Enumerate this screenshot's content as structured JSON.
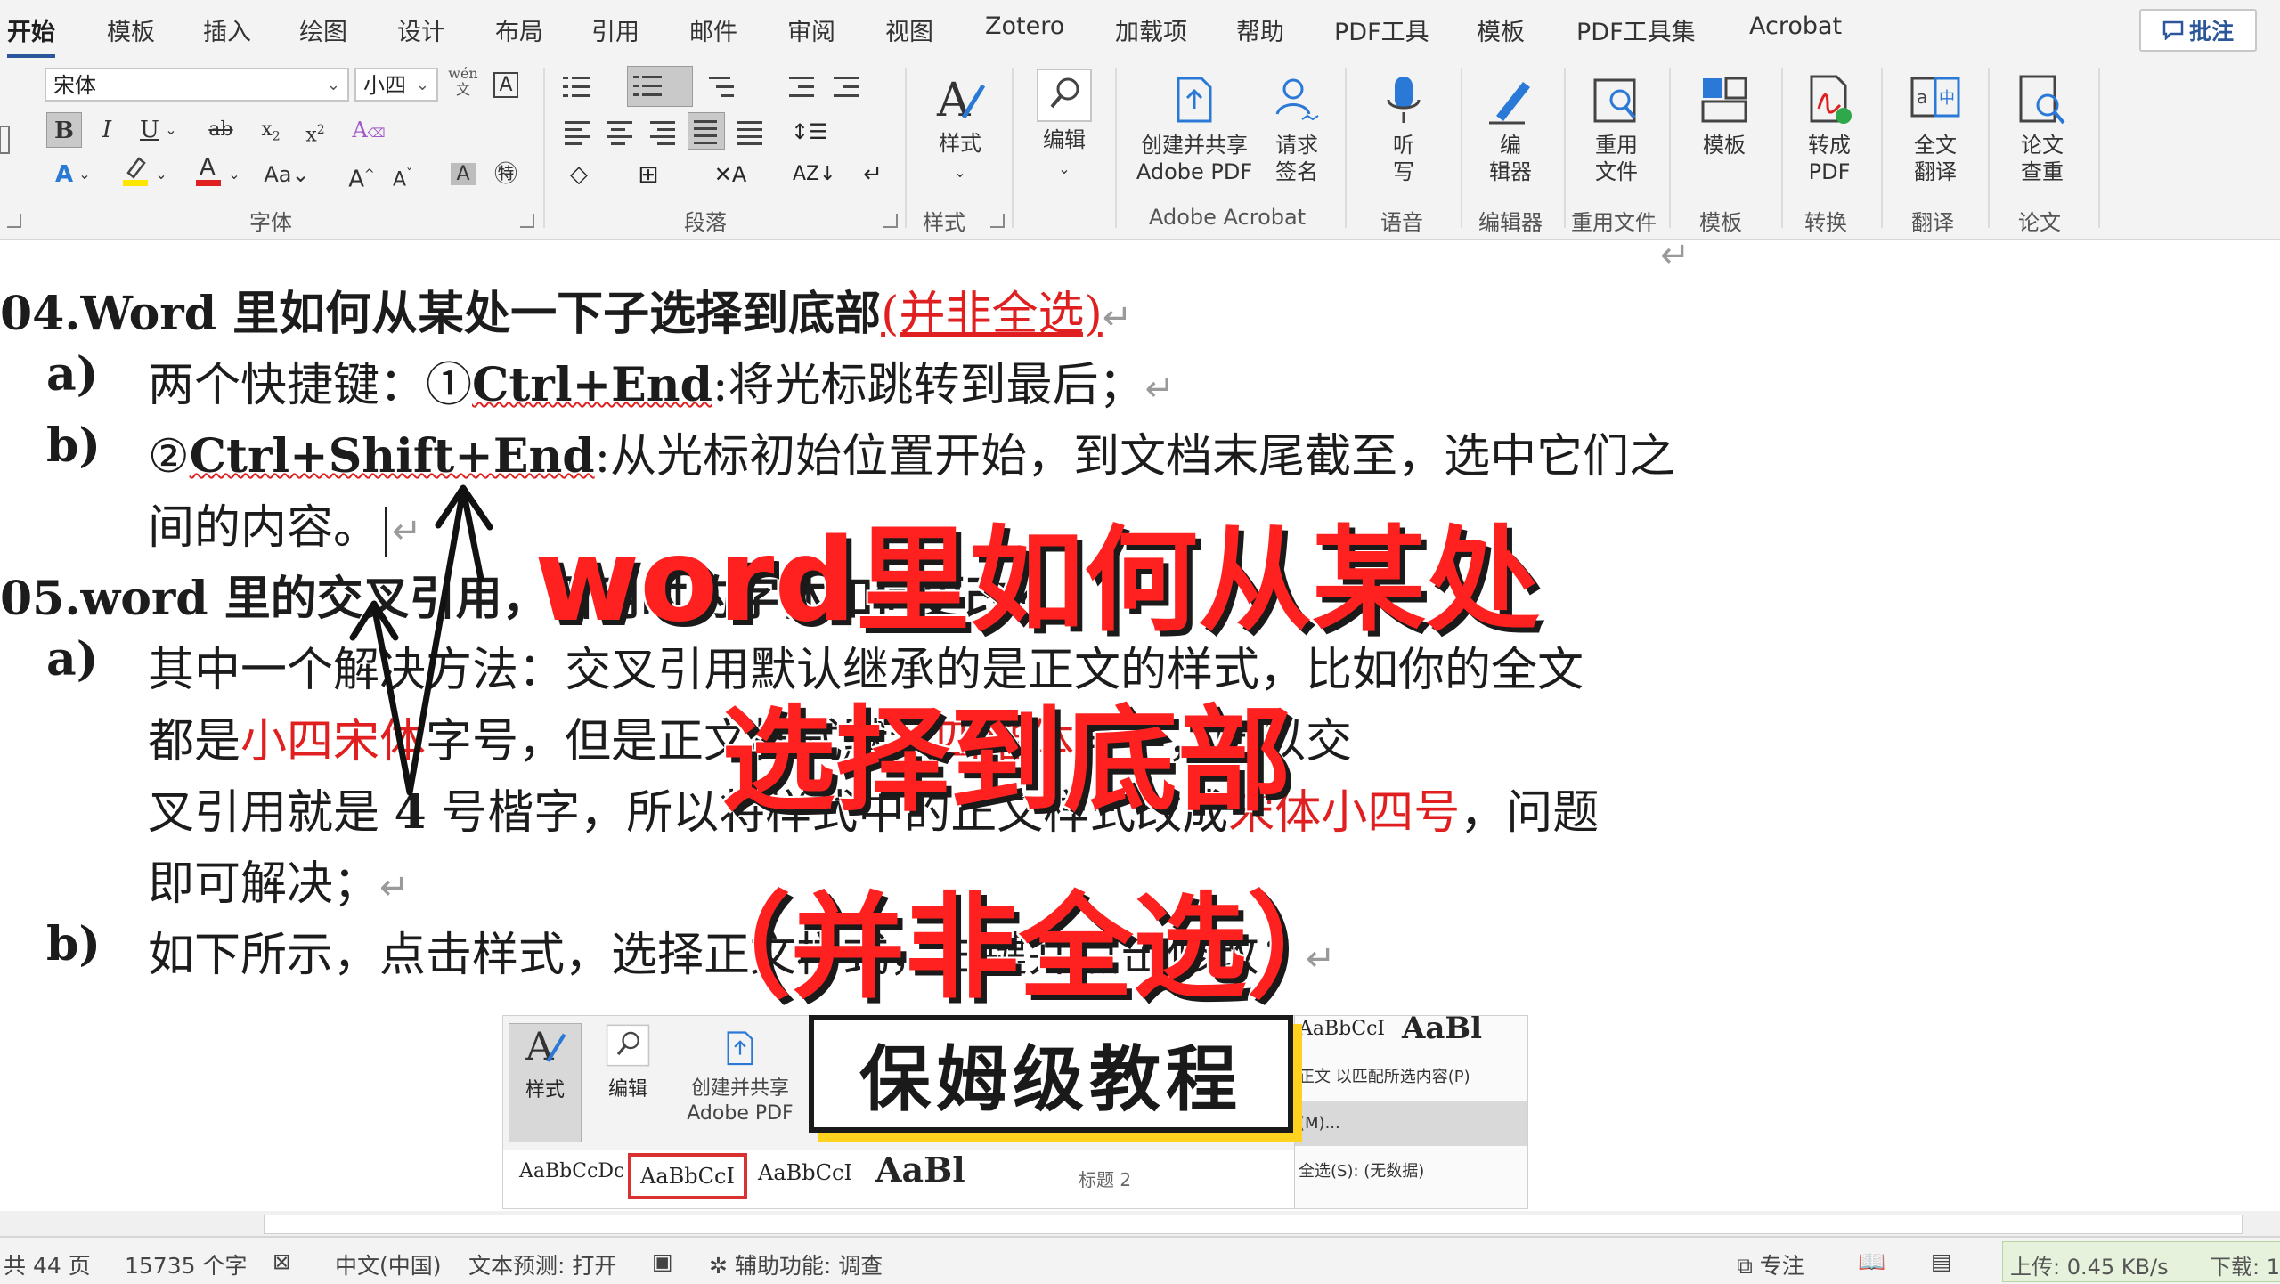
{
  "menu": {
    "tabs": [
      "开始",
      "模板",
      "插入",
      "绘图",
      "设计",
      "布局",
      "引用",
      "邮件",
      "审阅",
      "视图",
      "Zotero",
      "加载项",
      "帮助",
      "PDF工具",
      "模板",
      "PDF工具集",
      "Acrobat"
    ],
    "active_tab": "开始",
    "comment_label": "批注"
  },
  "ribbon": {
    "font": {
      "family": "宋体",
      "size": "小四",
      "group_label": "字体"
    },
    "paragraph": {
      "group_label": "段落"
    },
    "styles": {
      "button_label": "样式",
      "group_label": "样式"
    },
    "editing": {
      "button_label": "编辑"
    },
    "adobe": {
      "create_share_1": "创建并共享",
      "create_share_2": "Adobe PDF",
      "request_sign_1": "请求",
      "request_sign_2": "签名",
      "group_label": "Adobe Acrobat"
    },
    "voice": {
      "dictate_1": "听",
      "dictate_2": "写",
      "group_label": "语音"
    },
    "editor": {
      "button_1": "编",
      "button_2": "辑器",
      "group_label": "编辑器"
    },
    "reuse": {
      "button_1": "重用",
      "button_2": "文件",
      "group_label": "重用文件"
    },
    "template": {
      "button_label": "模板",
      "group_label": "模板"
    },
    "convert": {
      "button_1": "转成",
      "button_2": "PDF",
      "group_label": "转换"
    },
    "translate": {
      "button_1": "全文",
      "button_2": "翻译",
      "group_label": "翻译"
    },
    "thesis": {
      "button_1": "论文",
      "button_2": "查重",
      "group_label": "论文"
    },
    "colors": {
      "accent": "#2b579a",
      "highlight": "#ffe600",
      "font_color": "#e02020"
    }
  },
  "document": {
    "q4_title_prefix": "04.Word 里如何从某处一下子选择到底部",
    "q4_title_red": "(并非全选)",
    "q4_a_label": "a)",
    "q4_a_text1": "两个快捷键：①",
    "q4_a_bold": "Ctrl+End",
    "q4_a_text2": ":将光标跳转到最后；",
    "q4_b_label": "b)",
    "q4_b_text1": "②",
    "q4_b_bold": "Ctrl+Shift+End",
    "q4_b_text2": ":从光标初始位置开始，到文档末尾截至，选中它们之",
    "q4_b_text3": "间的内容。",
    "q5_title": "05.word 里的交叉引用，引用时的字体如何更改？",
    "q5_a_label": "a)",
    "q5_a_line1": "其中一个解决方法：交叉引用默认继承的是正文的样式，比如你的全文",
    "q5_a_line2_pre": "都是",
    "q5_a_line2_red1": "小四宋体",
    "q5_a_line2_mid": "字号，但是正文样式默认",
    "q5_a_line2_red2": "四楷体",
    "q5_a_line2_post": "号字，所以交",
    "q5_a_line3_pre": "叉引用就是 ",
    "q5_a_line3_bold": "4",
    "q5_a_line3_mid": " 号楷字，所以将样式中的正文样式改成",
    "q5_a_line3_red": "宋体小四号",
    "q5_a_line3_post": "，问题",
    "q5_a_line4": "即可解决；",
    "q5_b_label": "b)",
    "q5_b_text": "如下所示，点击样式，选择正文样式，右键并点击修改；",
    "return_mark": "↵"
  },
  "overlay": {
    "title_line1": "word里如何从某处",
    "title_line2": "选择到底部",
    "title_line3": "（并非全选）",
    "badge": "保姆级教程"
  },
  "embedded": {
    "styles_label": "样式",
    "edit_label": "编辑",
    "create_share_1": "创建并共享",
    "create_share_2": "Adobe PDF",
    "style_samples": [
      "AaBbCcDc",
      "AaBbCcI",
      "AaBbCcI",
      "AaBl"
    ],
    "style_names": [
      "标题 2"
    ],
    "menu_item_1": "正文 以匹配所选内容(P)",
    "menu_item_2": "(M)...",
    "menu_item_3": "全选(S): (无数据)",
    "preview_1": "AaBbCcI",
    "preview_2": "AaBl"
  },
  "status": {
    "pages": "共 44 页",
    "words": "15735 个字",
    "language": "中文(中国)",
    "text_predict": "文本预测: 打开",
    "accessibility": "辅助功能: 调查",
    "focus": "专注",
    "upload": "上传: 0.45 KB/s",
    "download": "下载: 1"
  }
}
